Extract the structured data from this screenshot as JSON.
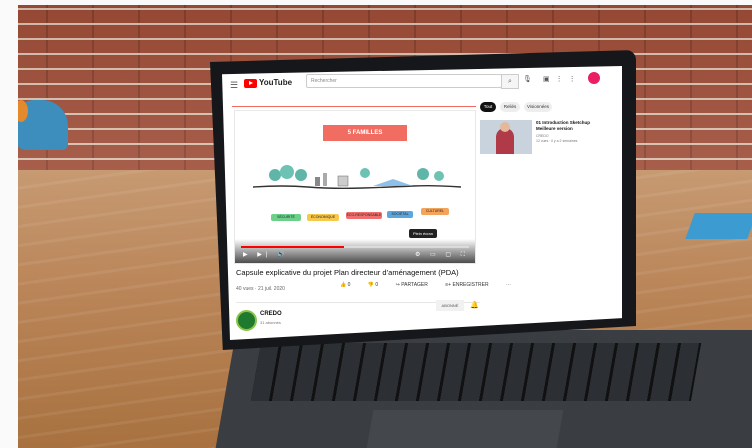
{
  "youtube": {
    "menu_icon": "menu-icon",
    "wordmark": "YouTube",
    "search_placeholder": "Rechercher",
    "search_icon": "search-icon",
    "slide_title": "5 FAMILLES",
    "categories": [
      "SÉCURITÉ",
      "ÉCONOMIQUE",
      "ÉCO-RESPONSABLE",
      "SOCIÉTAL",
      "CULTUREL"
    ],
    "tooltip": "Plein écran",
    "progress": 0.45,
    "video_title": "Capsule explicative du projet Plan directeur d’aménagement (PDA)",
    "video_meta": "40 vues · 21 juil. 2020",
    "likes": "0",
    "dislikes": "0",
    "share_label": "PARTAGER",
    "save_label": "ENREGISTRER",
    "channel_name": "CREDO",
    "channel_subs": "31 abonnés",
    "subscribe_label": "ABONNÉ",
    "chips": [
      "Tout",
      "Reliés",
      "Visionnées"
    ],
    "recommended": {
      "title": "01 Introduction Sketchup Meilleure version",
      "channel": "CREDO",
      "meta": "12 vues · il y a 2 semaines"
    }
  },
  "colors": {
    "youtube_red": "#ff0000",
    "slide_accent": "#f26d61",
    "brick": "#9c4b36"
  }
}
